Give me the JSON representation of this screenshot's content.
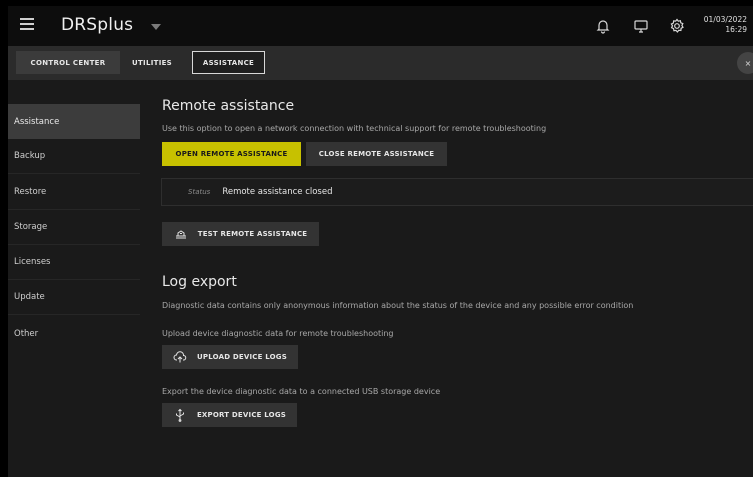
{
  "app": {
    "title": "DRSplus",
    "date": "01/03/2022",
    "time": "16:29",
    "accent": "#c7c100"
  },
  "icons": [
    "menu-icon",
    "dropdown-caret-icon",
    "bell-icon",
    "monitor-icon",
    "gear-icon",
    "close-icon",
    "handshake-icon",
    "cloud-upload-icon",
    "usb-icon"
  ],
  "tabs": {
    "control_center": "CONTROL CENTER",
    "utilities": "UTILITIES",
    "assistance": "ASSISTANCE",
    "close": "×"
  },
  "sidebar": {
    "items": [
      {
        "label": "Assistance",
        "active": true
      },
      {
        "label": "Backup"
      },
      {
        "label": "Restore"
      },
      {
        "label": "Storage"
      },
      {
        "label": "Licenses"
      },
      {
        "label": "Update"
      },
      {
        "label": "Other"
      }
    ]
  },
  "remote": {
    "title": "Remote assistance",
    "description": "Use this option to open a network connection with technical support for remote troubleshooting",
    "open_label": "OPEN REMOTE ASSISTANCE",
    "close_label": "CLOSE REMOTE ASSISTANCE",
    "status_label": "Status",
    "status_value": "Remote assistance closed",
    "test_label": "TEST REMOTE ASSISTANCE"
  },
  "log": {
    "title": "Log export",
    "description": "Diagnostic data contains only anonymous information about the status of the device and any possible error condition",
    "upload_desc": "Upload device diagnostic data for remote troubleshooting",
    "upload_label": "UPLOAD DEVICE LOGS",
    "export_desc": "Export the device diagnostic data to a connected USB storage device",
    "export_label": "EXPORT DEVICE LOGS"
  }
}
